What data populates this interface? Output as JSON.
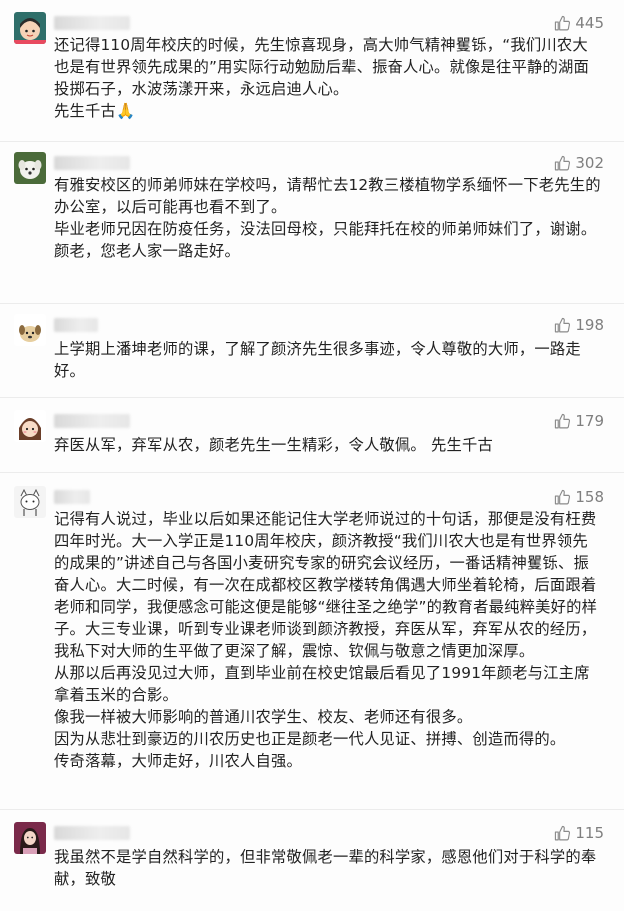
{
  "comments": [
    {
      "likes": "445",
      "paragraphs": [
        "还记得110周年校庆的时候，先生惊喜现身，高大帅气精神矍铄，“我们川农大也是有世界领先成果的”用实际行动勉励后辈、振奋人心。就像是往平静的湖面投掷石子，水波荡漾开来，永远启迪人心。",
        "先生千古🙏"
      ]
    },
    {
      "likes": "302",
      "paragraphs": [
        "有雅安校区的师弟师妹在学校吗，请帮忙去12教三楼植物学系缅怀一下老先生的办公室，以后可能再也看不到了。",
        "毕业老师兄因在防疫任务，没法回母校，只能拜托在校的师弟师妹们了，谢谢。",
        "颜老，您老人家一路走好。"
      ]
    },
    {
      "likes": "198",
      "paragraphs": [
        "上学期上潘坤老师的课，了解了颜济先生很多事迹，令人尊敬的大师，一路走好。"
      ]
    },
    {
      "likes": "179",
      "paragraphs": [
        "弃医从军，弃军从农，颜老先生一生精彩，令人敬佩。 先生千古"
      ]
    },
    {
      "likes": "158",
      "paragraphs": [
        "记得有人说过，毕业以后如果还能记住大学老师说过的十句话，那便是没有枉费四年时光。大一入学正是110周年校庆，颜济教授“我们川农大也是有世界领先的成果的”讲述自己与各国小麦研究专家的研究会议经历，一番话精神矍铄、振奋人心。大二时候，有一次在成都校区教学楼转角偶遇大师坐着轮椅，后面跟着老师和同学，我便感念可能这便是能够“继往圣之绝学”的教育者最纯粹美好的样子。大三专业课，听到专业课老师谈到颜济教授，弃医从军，弃军从农的经历，我私下对大师的生平做了更深了解，震惊、钦佩与敬意之情更加深厚。",
        "从那以后再没见过大师，直到毕业前在校史馆最后看见了1991年颜老与江主席拿着玉米的合影。",
        "像我一样被大师影响的普通川农学生、校友、老师还有很多。",
        "因为从悲壮到豪迈的川农历史也正是颜老一代人见证、拼搏、创造而得的。",
        "传奇落幕，大师走好，川农人自强。"
      ]
    },
    {
      "likes": "115",
      "paragraphs": [
        "我虽然不是学自然科学的，但非常敬佩老一辈的科学家，感恩他们对于科学的奉献，致敬"
      ]
    }
  ],
  "icons": {
    "like": "thumbs-up-icon",
    "avatars": [
      "cartoon-girl-avatar",
      "white-dog-avatar",
      "cartoon-dog-avatar",
      "cartoon-girl-avatar",
      "cat-avatar",
      "girl-portrait-avatar"
    ]
  },
  "colors": {
    "like_text": "#7f7f7f",
    "body_text": "#222222"
  }
}
